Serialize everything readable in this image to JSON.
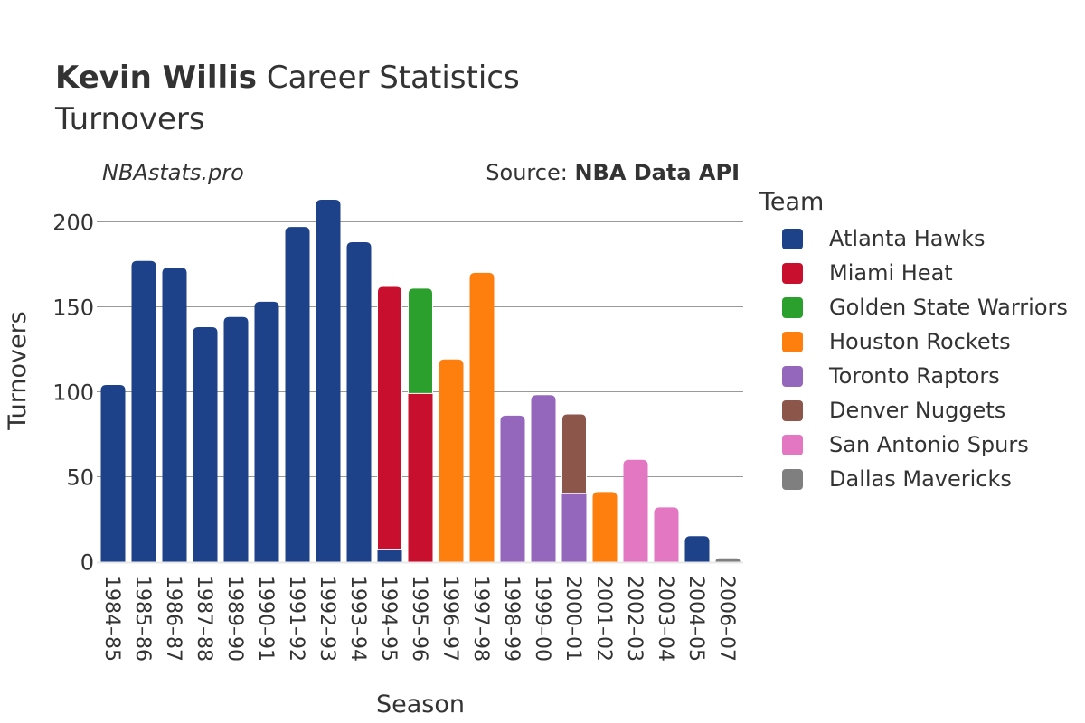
{
  "header": {
    "player_name": "Kevin Willis",
    "title_suffix": "Career Statistics",
    "subtitle": "Turnovers",
    "brand": "NBAstats.pro",
    "source_label": "Source:",
    "source_value": "NBA Data API"
  },
  "legend": {
    "title": "Team",
    "items": [
      {
        "label": "Atlanta Hawks",
        "color": "#1d428a"
      },
      {
        "label": "Miami Heat",
        "color": "#c8102e"
      },
      {
        "label": "Golden State Warriors",
        "color": "#2ca02c"
      },
      {
        "label": "Houston Rockets",
        "color": "#ff7f0e"
      },
      {
        "label": "Toronto Raptors",
        "color": "#9467bd"
      },
      {
        "label": "Denver Nuggets",
        "color": "#8c564b"
      },
      {
        "label": "San Antonio Spurs",
        "color": "#e377c2"
      },
      {
        "label": "Dallas Mavericks",
        "color": "#7f7f7f"
      }
    ]
  },
  "chart_data": {
    "type": "bar",
    "stacked": true,
    "title": "Kevin Willis Career Statistics",
    "subtitle": "Turnovers",
    "xlabel": "Season",
    "ylabel": "Turnovers",
    "ylim": [
      0,
      220
    ],
    "yticks": [
      0,
      50,
      100,
      150,
      200
    ],
    "grid": true,
    "legend_position": "right",
    "categories": [
      "1984–85",
      "1985–86",
      "1986–87",
      "1987–88",
      "1989–90",
      "1990–91",
      "1991–92",
      "1992–93",
      "1993–94",
      "1994–95",
      "1995–96",
      "1996–97",
      "1997–98",
      "1998–99",
      "1999–00",
      "2000–01",
      "2001–02",
      "2002–03",
      "2003–04",
      "2004–05",
      "2006–07"
    ],
    "series": [
      {
        "name": "Atlanta Hawks",
        "color": "#1d428a",
        "values": [
          104,
          177,
          173,
          138,
          144,
          153,
          197,
          213,
          188,
          7,
          0,
          0,
          0,
          0,
          0,
          0,
          0,
          0,
          0,
          15,
          0
        ]
      },
      {
        "name": "Miami Heat",
        "color": "#c8102e",
        "values": [
          0,
          0,
          0,
          0,
          0,
          0,
          0,
          0,
          0,
          155,
          99,
          0,
          0,
          0,
          0,
          0,
          0,
          0,
          0,
          0,
          0
        ]
      },
      {
        "name": "Golden State Warriors",
        "color": "#2ca02c",
        "values": [
          0,
          0,
          0,
          0,
          0,
          0,
          0,
          0,
          0,
          0,
          62,
          0,
          0,
          0,
          0,
          0,
          0,
          0,
          0,
          0,
          0
        ]
      },
      {
        "name": "Houston Rockets",
        "color": "#ff7f0e",
        "values": [
          0,
          0,
          0,
          0,
          0,
          0,
          0,
          0,
          0,
          0,
          0,
          119,
          170,
          0,
          0,
          0,
          41,
          0,
          0,
          0,
          0
        ]
      },
      {
        "name": "Toronto Raptors",
        "color": "#9467bd",
        "values": [
          0,
          0,
          0,
          0,
          0,
          0,
          0,
          0,
          0,
          0,
          0,
          0,
          0,
          86,
          98,
          40,
          0,
          0,
          0,
          0,
          0
        ]
      },
      {
        "name": "Denver Nuggets",
        "color": "#8c564b",
        "values": [
          0,
          0,
          0,
          0,
          0,
          0,
          0,
          0,
          0,
          0,
          0,
          0,
          0,
          0,
          0,
          47,
          0,
          0,
          0,
          0,
          0
        ]
      },
      {
        "name": "San Antonio Spurs",
        "color": "#e377c2",
        "values": [
          0,
          0,
          0,
          0,
          0,
          0,
          0,
          0,
          0,
          0,
          0,
          0,
          0,
          0,
          0,
          0,
          0,
          60,
          32,
          0,
          0
        ]
      },
      {
        "name": "Dallas Mavericks",
        "color": "#7f7f7f",
        "values": [
          0,
          0,
          0,
          0,
          0,
          0,
          0,
          0,
          0,
          0,
          0,
          0,
          0,
          0,
          0,
          0,
          0,
          0,
          0,
          0,
          2
        ]
      }
    ]
  }
}
